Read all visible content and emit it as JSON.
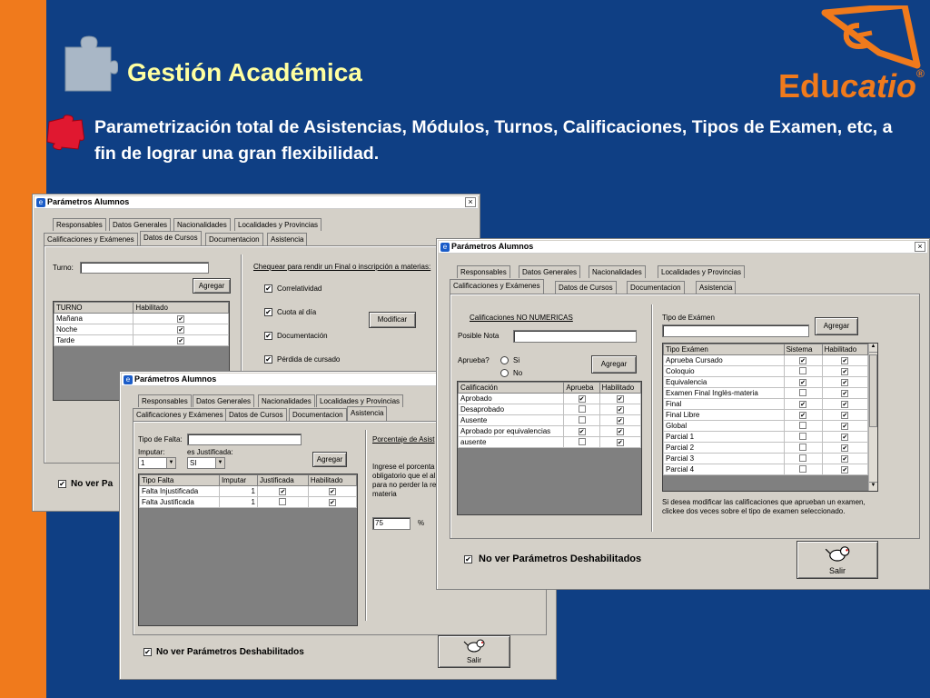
{
  "slide": {
    "title": "Gestión Académica",
    "description": "Parametrización total de Asistencias, Módulos, Turnos, Calificaciones, Tipos de Examen, etc, a fin de lograr una gran flexibilidad.",
    "logo_prefix": "Edu",
    "logo_suffix": "catio",
    "logo_mark": "®",
    "colors": {
      "background": "#0f3f84",
      "stripe": "#f07a1c",
      "title": "#ffffa0"
    }
  },
  "tabs_row1": [
    "Responsables",
    "Datos Generales",
    "Nacionalidades",
    "Localidades y Provincias"
  ],
  "tabs_row2": [
    "Calificaciones y Exámenes",
    "Datos de Cursos",
    "Documentacion",
    "Asistencia"
  ],
  "window_title": "Parámetros Alumnos",
  "close_glyph": "×",
  "win1": {
    "turno_label": "Turno:",
    "agregar": "Agregar",
    "turno_headers": [
      "TURNO",
      "Habilitado"
    ],
    "turnos": [
      {
        "name": "Mañana",
        "hab": true
      },
      {
        "name": "Noche",
        "hab": true
      },
      {
        "name": "Tarde",
        "hab": true
      }
    ],
    "chequear_label": "Chequear para rendir un Final o inscripción a materias:",
    "checks": [
      "Correlatividad",
      "Cuota al día",
      "Documentación",
      "Pérdida de cursado"
    ],
    "modificar": "Modificar",
    "no_ver": "No ver Pa"
  },
  "win2": {
    "tipo_falta": "Tipo de Falta:",
    "imputar": "Imputar:",
    "es_justificada": "es Justificada:",
    "imputar_val": "1",
    "justificada_val": "SI",
    "agregar": "Agregar",
    "headers": [
      "Tipo Falta",
      "Imputar",
      "Justificada",
      "Habilitado"
    ],
    "rows": [
      {
        "tipo": "Falta Injustificada",
        "imp": "1",
        "just": true,
        "hab": true
      },
      {
        "tipo": "Falta Justificada",
        "imp": "1",
        "just": false,
        "hab": true
      }
    ],
    "porcentaje_label": "Porcentaje de Asist",
    "porc_text": [
      "Ingrese el porcenta",
      "obligatorio que el al",
      "para no perder la re",
      "materia"
    ],
    "porc_val": "75",
    "porc_unit": "%",
    "no_ver": "No ver Parámetros Deshabilitados",
    "salir": "Salir"
  },
  "win3": {
    "calif_title": "Calificaciones NO NUMERICAS",
    "posible_nota": "Posible Nota",
    "aprueba": "Aprueba?",
    "si": "Si",
    "no": "No",
    "agregar": "Agregar",
    "calif_headers": [
      "Calificación",
      "Aprueba",
      "Habilitado"
    ],
    "calif_rows": [
      {
        "name": "Aprobado",
        "apr": true,
        "hab": true
      },
      {
        "name": "Desaprobado",
        "apr": false,
        "hab": true
      },
      {
        "name": "Ausente",
        "apr": false,
        "hab": true
      },
      {
        "name": "Aprobado por equivalencias",
        "apr": true,
        "hab": true
      },
      {
        "name": "ausente",
        "apr": false,
        "hab": true
      }
    ],
    "tipo_examen": "Tipo de Exámen",
    "agregar2": "Agregar",
    "exam_headers": [
      "Tipo Exámen",
      "Sistema",
      "Habilitado"
    ],
    "exam_rows": [
      {
        "name": "Aprueba Cursado",
        "sis": true,
        "hab": true
      },
      {
        "name": "Coloquio",
        "sis": false,
        "hab": true
      },
      {
        "name": "Equivalencia",
        "sis": true,
        "hab": true
      },
      {
        "name": "Examen Final Inglès-materia",
        "sis": false,
        "hab": true
      },
      {
        "name": "Final",
        "sis": true,
        "hab": true
      },
      {
        "name": "Final Libre",
        "sis": true,
        "hab": true
      },
      {
        "name": "Global",
        "sis": false,
        "hab": true
      },
      {
        "name": "Parcial 1",
        "sis": false,
        "hab": true
      },
      {
        "name": "Parcial 2",
        "sis": false,
        "hab": true
      },
      {
        "name": "Parcial 3",
        "sis": false,
        "hab": true
      },
      {
        "name": "Parcial 4",
        "sis": false,
        "hab": true
      }
    ],
    "hint": "Si desea modificar las calificaciones que aprueban un examen, clickee dos veces sobre el tipo de examen seleccionado.",
    "no_ver": "No ver Parámetros Deshabilitados",
    "salir": "Salir"
  }
}
